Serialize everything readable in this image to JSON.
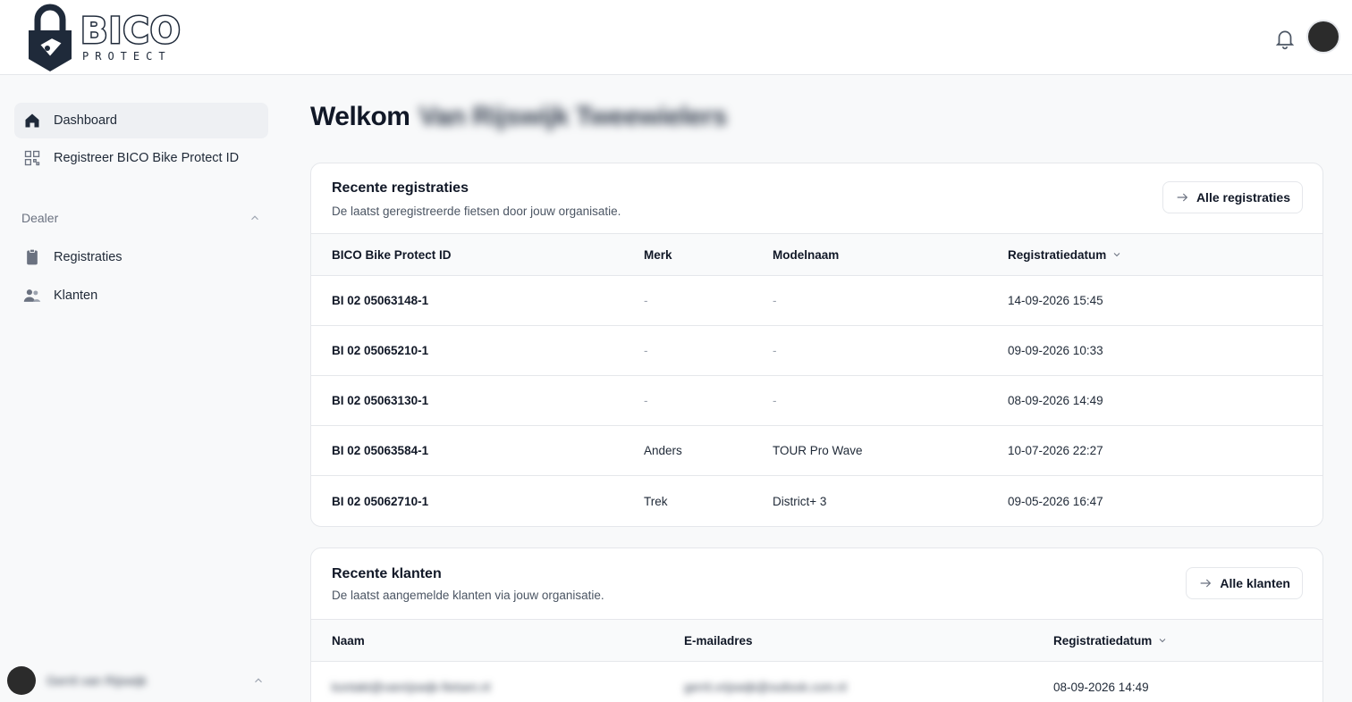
{
  "brand": {
    "name": "BICO",
    "sub": "PROTECT"
  },
  "sidebar": {
    "items": [
      {
        "label": "Dashboard",
        "icon": "home-icon"
      },
      {
        "label": "Registreer BICO Bike Protect ID",
        "icon": "qr-code-icon"
      }
    ],
    "section": {
      "label": "Dealer"
    },
    "dealer_items": [
      {
        "label": "Registraties",
        "icon": "clipboard-icon"
      },
      {
        "label": "Klanten",
        "icon": "users-icon"
      }
    ],
    "user": {
      "name": "Gerrit van Rijswijk"
    }
  },
  "welcome": {
    "prefix": "Welkom",
    "name": "Van Rijswijk Tweewielers"
  },
  "registrations": {
    "title": "Recente registraties",
    "subtitle": "De laatst geregistreerde fietsen door jouw organisatie.",
    "button": "Alle registraties",
    "columns": [
      "BICO Bike Protect ID",
      "Merk",
      "Modelnaam",
      "Registratiedatum"
    ],
    "rows": [
      {
        "id": "BI 02 05063148-1",
        "merk": "-",
        "model": "-",
        "date": "14-09-2026 15:45"
      },
      {
        "id": "BI 02 05065210-1",
        "merk": "-",
        "model": "-",
        "date": "09-09-2026 10:33"
      },
      {
        "id": "BI 02 05063130-1",
        "merk": "-",
        "model": "-",
        "date": "08-09-2026 14:49"
      },
      {
        "id": "BI 02 05063584-1",
        "merk": "Anders",
        "model": "TOUR Pro Wave",
        "date": "10-07-2026 22:27"
      },
      {
        "id": "BI 02 05062710-1",
        "merk": "Trek",
        "model": "District+ 3",
        "date": "09-05-2026 16:47"
      }
    ]
  },
  "customers": {
    "title": "Recente klanten",
    "subtitle": "De laatst aangemelde klanten via jouw organisatie.",
    "button": "Alle klanten",
    "columns": [
      "Naam",
      "E-mailadres",
      "Registratiedatum"
    ],
    "rows": [
      {
        "name": "kontakt@vanrijswijk-fietsen.nl",
        "email": "gerrit.vrijswijk@outlook.com.nl",
        "date": "08-09-2026 14:49"
      }
    ]
  },
  "colors": {
    "accent": "#1f2a3a",
    "border": "#e5e7eb",
    "muted": "#6b7280"
  }
}
